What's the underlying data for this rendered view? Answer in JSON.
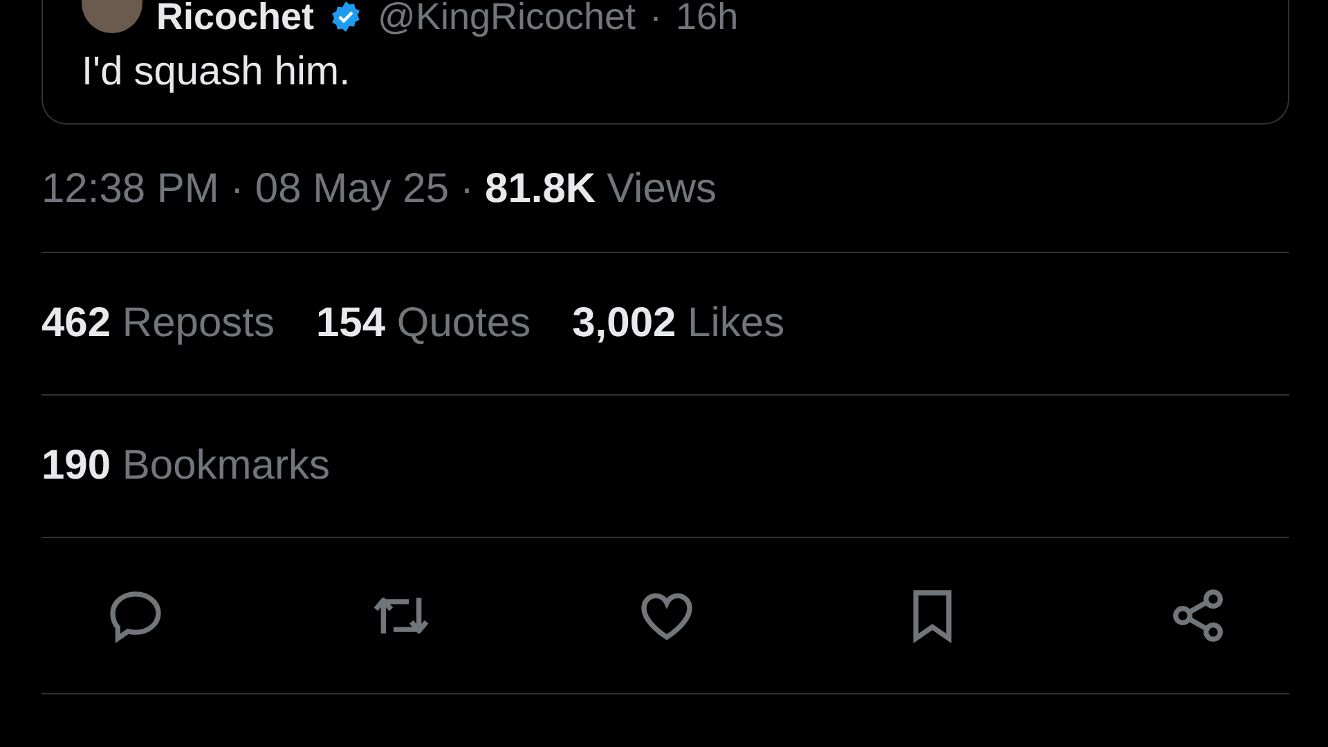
{
  "quoted_tweet": {
    "name": "Ricochet",
    "verified": true,
    "handle": "@KingRicochet",
    "separator": "·",
    "time": "16h",
    "text": "I'd squash him."
  },
  "timestamp": {
    "time": "12:38 PM",
    "separator": "·",
    "date": "08 May 25",
    "views_count": "81.8K",
    "views_label": "Views"
  },
  "stats": [
    {
      "count": "462",
      "label": "Reposts"
    },
    {
      "count": "154",
      "label": "Quotes"
    },
    {
      "count": "3,002",
      "label": "Likes"
    }
  ],
  "bookmarks": {
    "count": "190",
    "label": "Bookmarks"
  },
  "actions": [
    {
      "kind": "reply"
    },
    {
      "kind": "repost"
    },
    {
      "kind": "like"
    },
    {
      "kind": "bookmark"
    },
    {
      "kind": "share"
    }
  ]
}
